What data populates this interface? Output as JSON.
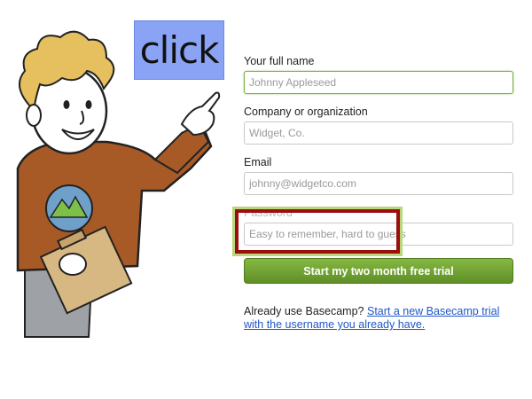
{
  "callout": {
    "text": "click"
  },
  "form": {
    "full_name": {
      "label": "Your full name",
      "placeholder": "Johnny Appleseed"
    },
    "company": {
      "label": "Company or organization",
      "placeholder": "Widget, Co."
    },
    "email": {
      "label": "Email",
      "placeholder": "johnny@widgetco.com"
    },
    "password": {
      "label": "Password",
      "placeholder": "Easy to remember, hard to guess"
    },
    "submit_label": "Start my two month free trial"
  },
  "footer": {
    "prefix": "Already use Basecamp?",
    "link_text": "Start a new Basecamp trial with the username you already have."
  },
  "colors": {
    "button_green": "#6fa02f",
    "link_blue": "#1f57c8",
    "highlight_red": "#9a0e0e",
    "callout_blue": "#8aa3f5"
  },
  "icons": {
    "basecamp_shirt_logo": "basecamp-mountain-icon"
  }
}
